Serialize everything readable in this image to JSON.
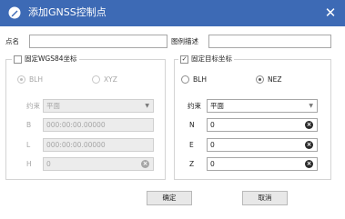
{
  "window": {
    "title": "添加GNSS控制点",
    "close_glyph": "✕",
    "app_icon": "pen-icon",
    "accent_color": "#3d6ab5"
  },
  "top_fields": {
    "point_name_label": "点名",
    "point_name_value": "",
    "legend_desc_label": "图例描述",
    "legend_desc_value": ""
  },
  "wgs84_group": {
    "title": "固定WGS84坐标",
    "checked": false,
    "radio_blh": "BLH",
    "radio_xyz": "XYZ",
    "selected": "BLH",
    "constraint_label": "约束",
    "constraint_value": "平面",
    "rows": [
      {
        "label": "B",
        "value": "000:00:00.00000"
      },
      {
        "label": "L",
        "value": "000:00:00.00000"
      },
      {
        "label": "H",
        "value": "0"
      }
    ]
  },
  "target_group": {
    "title": "固定目标坐标",
    "checked": true,
    "check_glyph": "✓",
    "radio_blh": "BLH",
    "radio_nez": "NEZ",
    "selected": "NEZ",
    "constraint_label": "约束",
    "constraint_value": "平面",
    "rows": [
      {
        "label": "N",
        "value": "0"
      },
      {
        "label": "E",
        "value": "0"
      },
      {
        "label": "Z",
        "value": "0"
      }
    ]
  },
  "buttons": {
    "ok": "确定",
    "cancel": "取消"
  }
}
